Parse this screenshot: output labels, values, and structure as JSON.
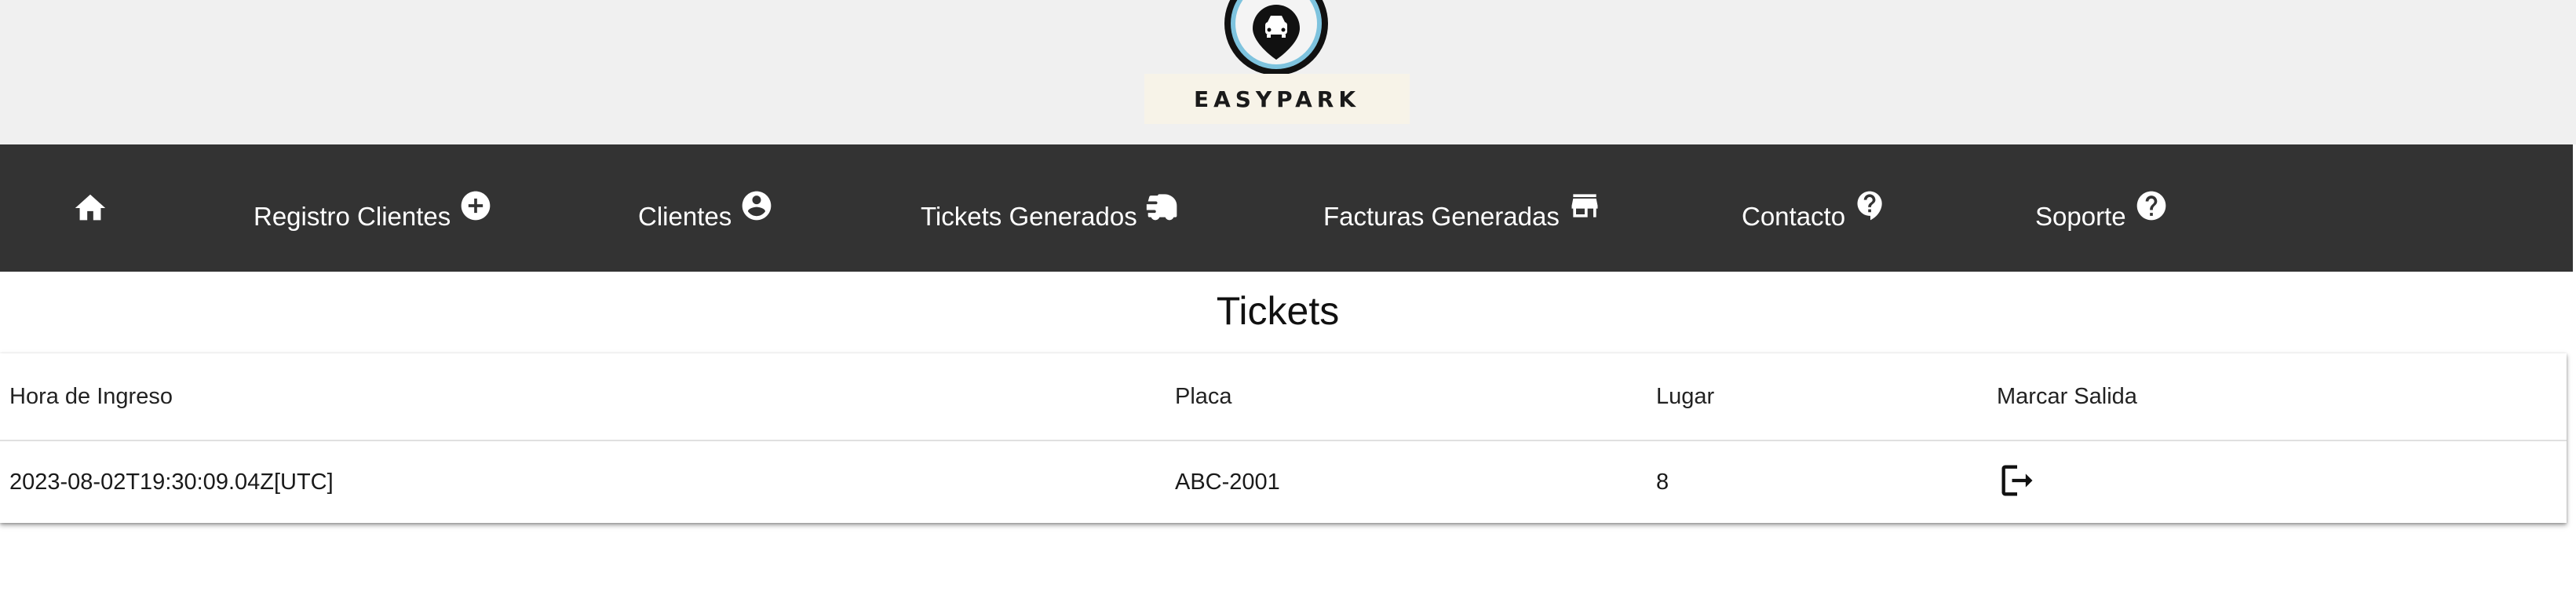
{
  "brand": {
    "name": "EASYPARK",
    "colors": {
      "ring_outer": "#111111",
      "ring_inner": "#7ec3de",
      "plate": "#f7f3e8"
    },
    "icon": "car-pin-icon"
  },
  "navbar": {
    "background": "#333333",
    "items": [
      {
        "label": "",
        "icon": "home-icon"
      },
      {
        "label": "Registro Clientes",
        "icon": "add-circle-icon"
      },
      {
        "label": "Clientes",
        "icon": "account-circle-icon"
      },
      {
        "label": "Tickets Generados",
        "icon": "cars-icon"
      },
      {
        "label": "Facturas Generadas",
        "icon": "store-icon"
      },
      {
        "label": "Contacto",
        "icon": "help-icon"
      },
      {
        "label": "Soporte",
        "icon": "help-circle-icon"
      }
    ]
  },
  "page": {
    "title": "Tickets"
  },
  "table": {
    "columns": [
      "Hora de Ingreso",
      "Placa",
      "Lugar",
      "Marcar Salida"
    ],
    "rows": [
      {
        "hora_ingreso": "2023-08-02T19:30:09.04Z[UTC]",
        "placa": "ABC-2001",
        "lugar": "8",
        "accion_icon": "logout-icon"
      }
    ]
  }
}
